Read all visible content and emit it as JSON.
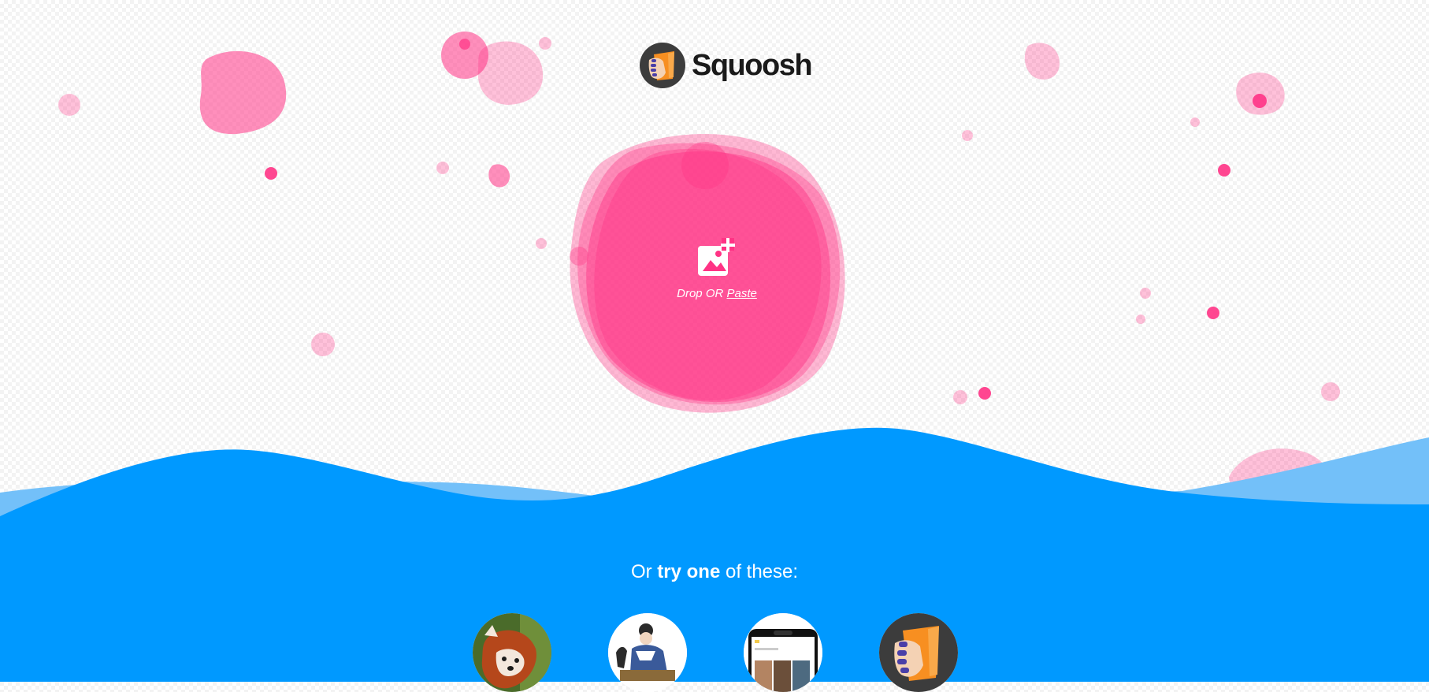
{
  "app": {
    "name": "Squoosh"
  },
  "colors": {
    "pink": "#ff3385",
    "pink_light": "#ff7eb0",
    "blue": "#0099ff",
    "blue_light": "#73c0f9",
    "logo_dark": "#3c3c3c",
    "logo_orange": "#f78f21"
  },
  "dropzone": {
    "icon": "add-image-icon",
    "drop_text": "Drop OR",
    "paste_link": "Paste"
  },
  "try": {
    "prefix": "Or",
    "bold": "try one",
    "suffix": "of these:"
  },
  "demos": [
    {
      "name": "red-panda-demo"
    },
    {
      "name": "artwork-demo"
    },
    {
      "name": "device-screenshot-demo"
    },
    {
      "name": "squoosh-logo-demo"
    }
  ]
}
